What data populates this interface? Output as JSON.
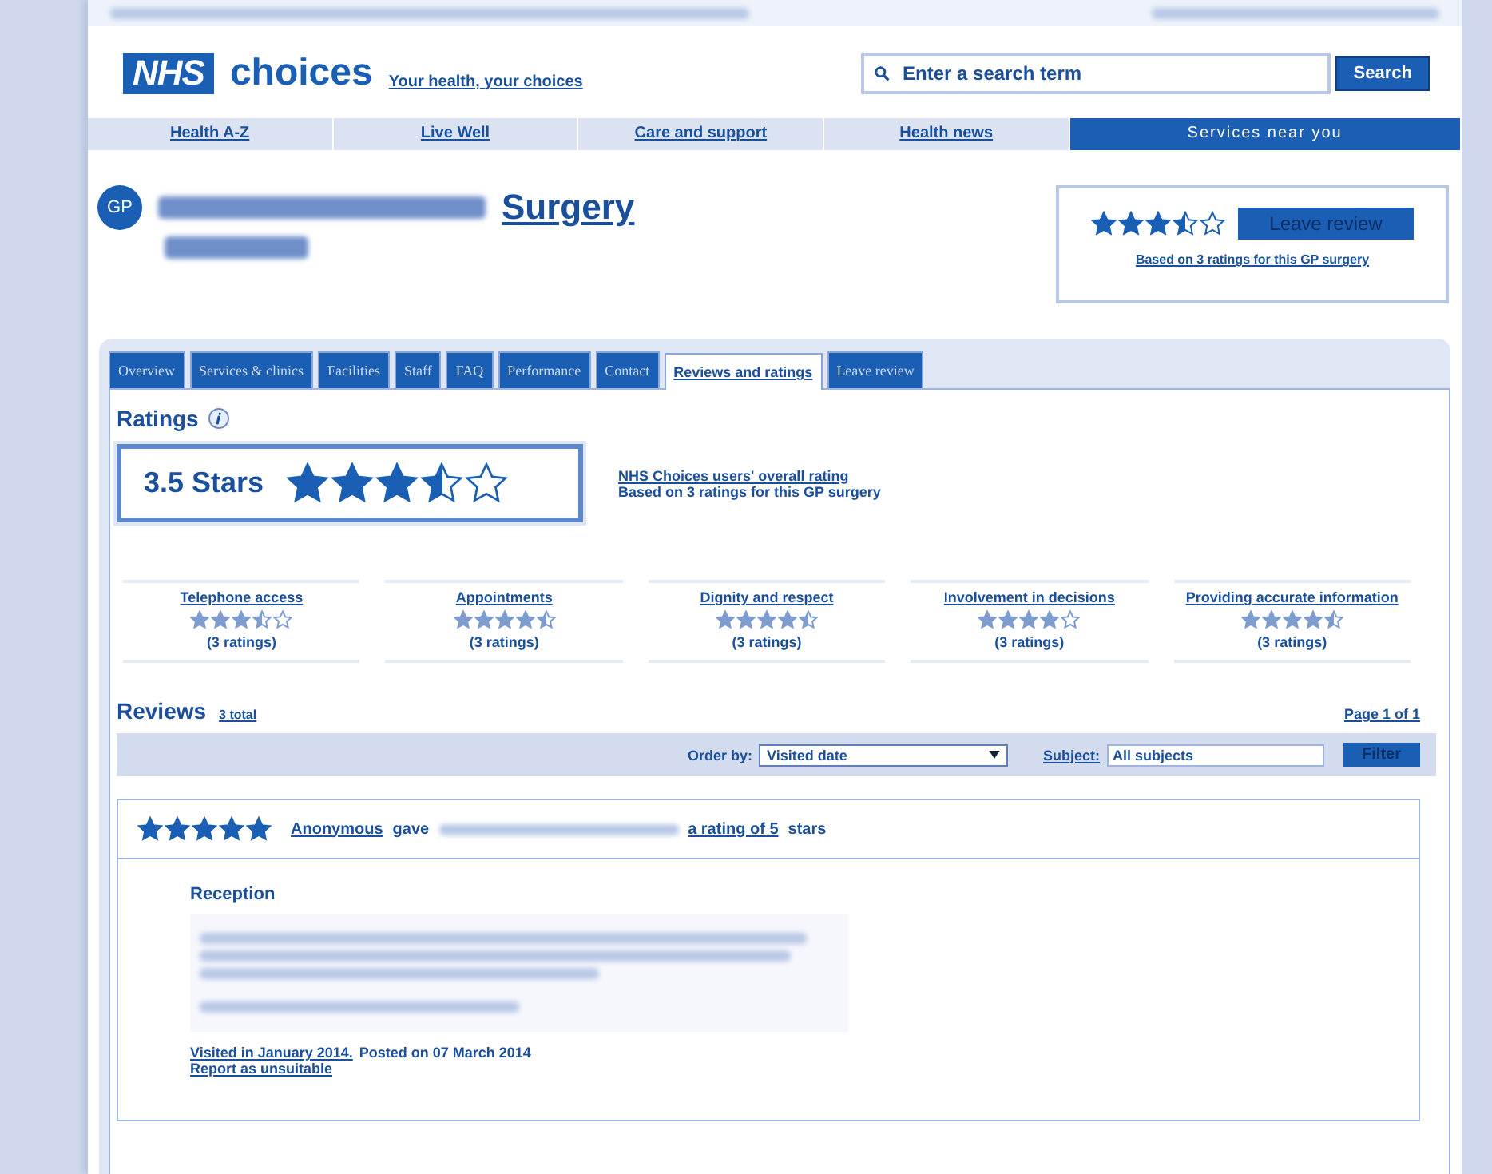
{
  "header": {
    "logo": "NHS",
    "brand": "choices",
    "tagline": "Your health, your choices",
    "search": {
      "placeholder": "Enter a search term",
      "button": "Search"
    }
  },
  "nav": [
    {
      "label": "Health A-Z",
      "selected": false
    },
    {
      "label": "Live Well",
      "selected": false
    },
    {
      "label": "Care and support",
      "selected": false
    },
    {
      "label": "Health news",
      "selected": false
    },
    {
      "label": "Services near you",
      "selected": true
    }
  ],
  "practice": {
    "badge": "GP",
    "title": "Surgery"
  },
  "summary": {
    "stars": 3.5,
    "button": "Leave review",
    "note": "Based on 3 ratings for this GP surgery"
  },
  "tabs": [
    {
      "label": "Overview",
      "selected": false
    },
    {
      "label": "Services & clinics",
      "selected": false
    },
    {
      "label": "Facilities",
      "selected": false
    },
    {
      "label": "Staff",
      "selected": false
    },
    {
      "label": "FAQ",
      "selected": false
    },
    {
      "label": "Performance",
      "selected": false
    },
    {
      "label": "Contact",
      "selected": false
    },
    {
      "label": "Reviews and ratings",
      "selected": true
    },
    {
      "label": "Leave review",
      "selected": false
    }
  ],
  "ratings": {
    "heading": "Ratings",
    "score": "3.5 Stars",
    "stars": 3.5,
    "overall_link": "NHS Choices users' overall rating",
    "based": "Based on 3 ratings for this GP surgery",
    "categories": [
      {
        "name": "Telephone access",
        "stars": 3.5,
        "count": "(3 ratings)"
      },
      {
        "name": "Appointments",
        "stars": 4.5,
        "count": "(3 ratings)"
      },
      {
        "name": "Dignity and respect",
        "stars": 4.5,
        "count": "(3 ratings)"
      },
      {
        "name": "Involvement in decisions",
        "stars": 4,
        "count": "(3 ratings)"
      },
      {
        "name": "Providing accurate information",
        "stars": 4.5,
        "count": "(3 ratings)"
      }
    ]
  },
  "reviews": {
    "heading": "Reviews",
    "total": "3 total",
    "page": "Page 1 of 1",
    "order_label": "Order by:",
    "order_value": "Visited date",
    "subject_label": "Subject:",
    "subject_value": "All subjects",
    "filter": "Filter",
    "items": [
      {
        "stars": 5,
        "author": "Anonymous",
        "gave": "gave",
        "rating_text": "a rating of 5",
        "tail": "stars",
        "section": "Reception",
        "visited": "Visited in January 2014.",
        "posted": "Posted on 07 March 2014",
        "report": "Report as unsuitable"
      }
    ]
  }
}
